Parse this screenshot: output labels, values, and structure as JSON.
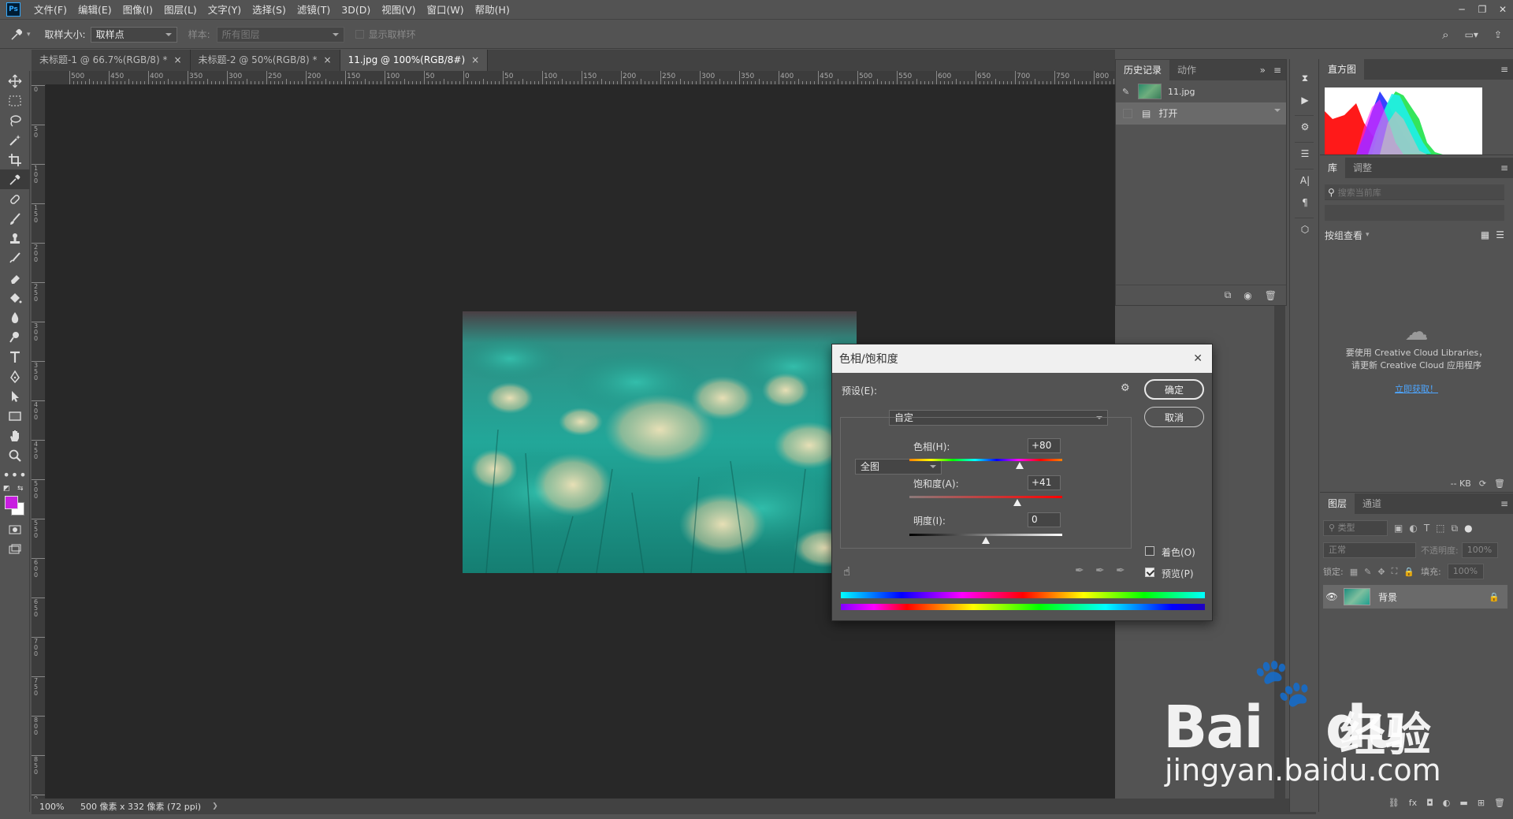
{
  "app": {
    "logo": "Ps"
  },
  "menu": [
    "文件(F)",
    "编辑(E)",
    "图像(I)",
    "图层(L)",
    "文字(Y)",
    "选择(S)",
    "滤镜(T)",
    "3D(D)",
    "视图(V)",
    "窗口(W)",
    "帮助(H)"
  ],
  "options": {
    "sample_size_label": "取样大小:",
    "sample_size_value": "取样点",
    "sample_label": "样本:",
    "sample_value": "所有图层",
    "show_ring_label": "显示取样环"
  },
  "tabs": [
    {
      "label": "未标题-1 @ 66.7%(RGB/8) *",
      "close": "×"
    },
    {
      "label": "未标题-2 @ 50%(RGB/8) *",
      "close": "×"
    },
    {
      "label": "11.jpg @ 100%(RGB/8#)",
      "close": "×"
    }
  ],
  "ruler": {
    "top": [
      "500",
      "450",
      "400",
      "350",
      "300",
      "250",
      "200",
      "150",
      "100",
      "50",
      "0",
      "50",
      "100",
      "150",
      "200",
      "250",
      "300",
      "350",
      "400",
      "450",
      "500",
      "550",
      "600",
      "650",
      "700",
      "750",
      "800"
    ],
    "left": [
      "0",
      "5 0",
      "1 0 0",
      "1 5 0",
      "2 0 0",
      "2 5 0",
      "3 0 0",
      "3 5 0",
      "4 0 0",
      "4 5 0",
      "5 0 0",
      "5 5 0",
      "6 0 0",
      "6 5 0",
      "7 0 0",
      "7 5 0",
      "8 0 0",
      "8 5 0",
      "9 0 0",
      "9 5 0"
    ]
  },
  "status": {
    "zoom": "100%",
    "doc_info": "500 像素 x 332 像素 (72 ppi)",
    "arrow": "❯"
  },
  "history_panel": {
    "tabs": [
      "历史记录",
      "动作"
    ],
    "snapshot": "11.jpg",
    "items": [
      "打开"
    ]
  },
  "histogram_panel": {
    "tab": "直方图"
  },
  "library_panel": {
    "tabs": [
      "库",
      "调整"
    ],
    "search_placeholder": "搜索当前库",
    "view_label": "按组查看",
    "message_line1": "要使用 Creative Cloud Libraries，",
    "message_line2": "请更新 Creative Cloud 应用程序",
    "link": "立即获取！",
    "size": "-- KB"
  },
  "layers_panel": {
    "tabs": [
      "图层",
      "通道"
    ],
    "filter": "类型",
    "blend_mode": "正常",
    "opacity_label": "不透明度:",
    "opacity_value": "100%",
    "lock_label": "锁定:",
    "fill_label": "填充:",
    "fill_value": "100%",
    "layer_name": "背景"
  },
  "dialog": {
    "title": "色相/饱和度",
    "close": "✕",
    "preset_label": "预设(E):",
    "preset_value": "自定",
    "range_value": "全图",
    "hue_label": "色相(H):",
    "hue_value": "+80",
    "saturation_label": "饱和度(A):",
    "saturation_value": "+41",
    "lightness_label": "明度(I):",
    "lightness_value": "0",
    "ok": "确定",
    "cancel": "取消",
    "colorize_label": "着色(O)",
    "preview_label": "预览(P)",
    "hue_level": 0.7222,
    "saturation_level": 0.705,
    "lightness_level": 0.5,
    "colorize_checked": false,
    "preview_checked": true
  },
  "watermark": {
    "logo_text": "Bai",
    "logo_text2": "du",
    "cn": "经验",
    "url": "jingyan.baidu.com"
  },
  "colors": {
    "foreground": "#c81ee0",
    "background": "#ffffff",
    "accent_link": "#4ea6ff"
  }
}
